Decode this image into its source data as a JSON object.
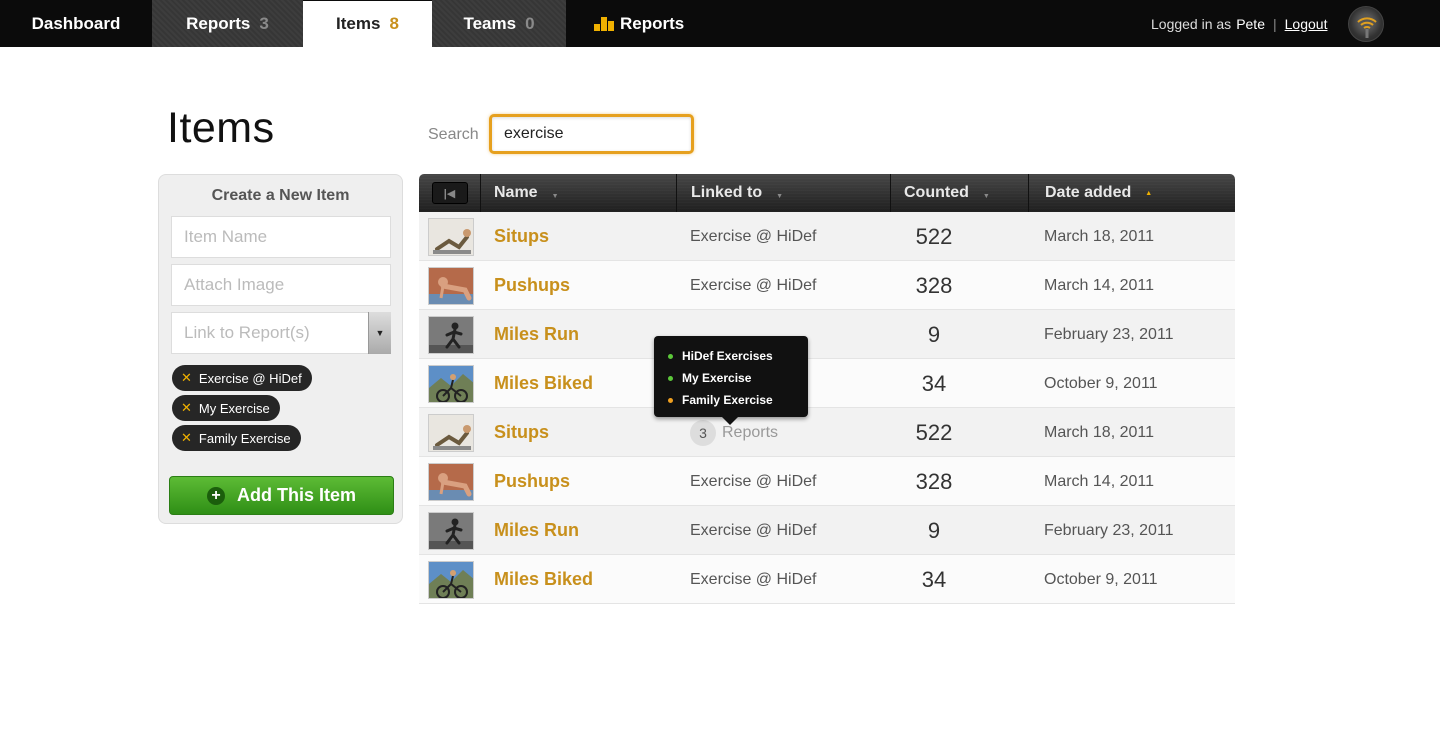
{
  "nav": {
    "tabs": [
      {
        "label": "Dashboard",
        "count": ""
      },
      {
        "label": "Reports",
        "count": "3"
      },
      {
        "label": "Items",
        "count": "8"
      },
      {
        "label": "Teams",
        "count": "0"
      },
      {
        "label": "Reports",
        "count": ""
      }
    ],
    "active_tab": "Items",
    "logged_in_prefix": "Logged in as",
    "username": "Pete",
    "separator": "|",
    "logout_label": "Logout",
    "reports_icon": "bar-chart-icon",
    "accent_color": "#f0b100"
  },
  "page": {
    "title": "Items",
    "search_label": "Search",
    "search_value": "exercise"
  },
  "create_panel": {
    "title": "Create a New Item",
    "item_name_placeholder": "Item Name",
    "attach_image_placeholder": "Attach Image",
    "link_reports_placeholder": "Link to Report(s)",
    "tags": [
      "Exercise @ HiDef",
      "My Exercise",
      "Family Exercise"
    ],
    "tag_remove_icon": "close-icon",
    "add_button_label": "Add This Item",
    "add_button_color": "#3ea023"
  },
  "table": {
    "columns": [
      "Name",
      "Linked to",
      "Counted",
      "Date added"
    ],
    "sorted_column": "Date added",
    "rows": [
      {
        "name": "Situps",
        "linked": "Exercise @ HiDef",
        "counted": "522",
        "date": "March 18, 2011",
        "thumb": "situps"
      },
      {
        "name": "Pushups",
        "linked": "Exercise @ HiDef",
        "counted": "328",
        "date": "March 14, 2011",
        "thumb": "pushups"
      },
      {
        "name": "Miles Run",
        "linked": "",
        "counted": "9",
        "date": "February 23, 2011",
        "thumb": "run"
      },
      {
        "name": "Miles Biked",
        "linked": "",
        "counted": "34",
        "date": "October 9, 2011",
        "thumb": "bike"
      },
      {
        "name": "Situps",
        "linked": "",
        "linked_count": "3",
        "linked_word": "Reports",
        "counted": "522",
        "date": "March 18, 2011",
        "thumb": "situps"
      },
      {
        "name": "Pushups",
        "linked": "Exercise @ HiDef",
        "counted": "328",
        "date": "March 14, 2011",
        "thumb": "pushups"
      },
      {
        "name": "Miles Run",
        "linked": "Exercise @ HiDef",
        "counted": "9",
        "date": "February 23, 2011",
        "thumb": "run"
      },
      {
        "name": "Miles Biked",
        "linked": "Exercise @ HiDef",
        "counted": "34",
        "date": "October 9, 2011",
        "thumb": "bike"
      }
    ],
    "name_color": "#c8901c"
  },
  "tooltip": {
    "items": [
      {
        "label": "HiDef Exercises",
        "color": "#5cc83a"
      },
      {
        "label": "My Exercise",
        "color": "#5cc83a"
      },
      {
        "label": "Family Exercise",
        "color": "#f0a020"
      }
    ]
  }
}
